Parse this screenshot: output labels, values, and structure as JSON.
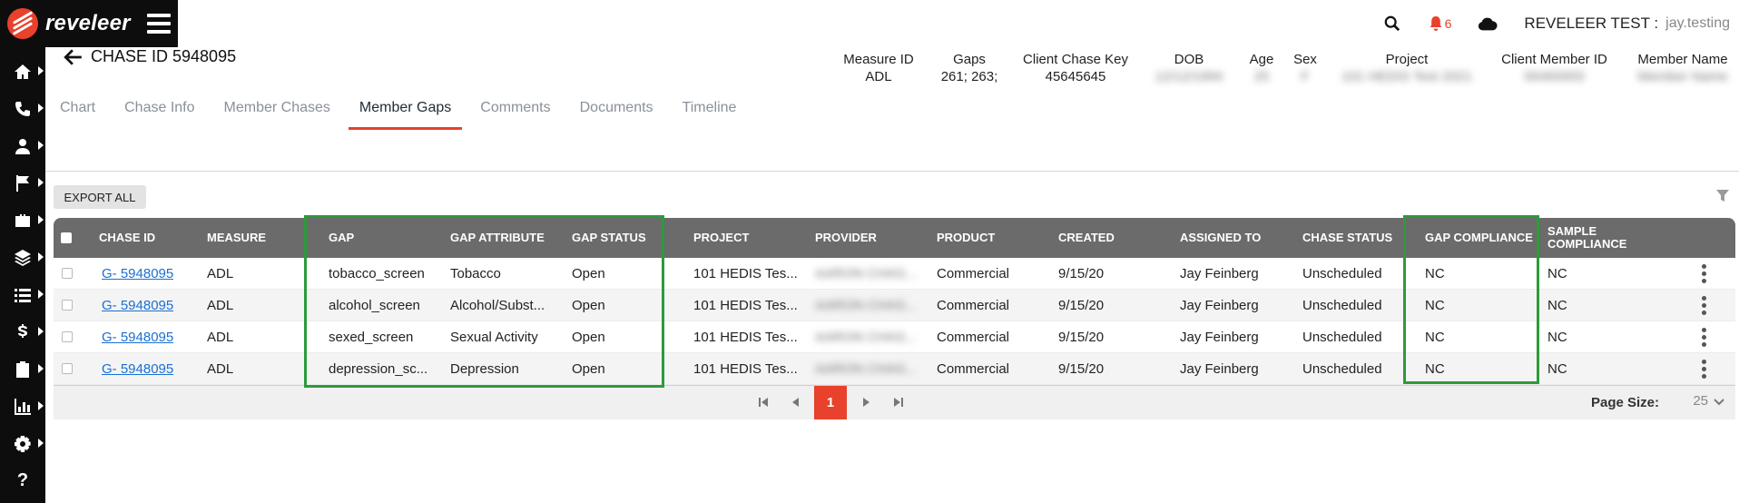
{
  "app": {
    "brand": "reveleer"
  },
  "topbar": {
    "notifications_count": "6",
    "user_label": "REVELEER TEST :",
    "user_name": "jay.testing"
  },
  "header": {
    "title": "CHASE ID 5948095",
    "meta": [
      {
        "label": "Measure ID",
        "value": "ADL",
        "blurred": false
      },
      {
        "label": "Gaps",
        "value": "261; 263;",
        "blurred": false
      },
      {
        "label": "Client Chase Key",
        "value": "45645645",
        "blurred": false
      },
      {
        "label": "DOB",
        "value": "12/12/1994",
        "blurred": true
      },
      {
        "label": "Age",
        "value": "25",
        "blurred": true
      },
      {
        "label": "Sex",
        "value": "F",
        "blurred": true
      },
      {
        "label": "Project",
        "value": "101 HEDIS Test 2021",
        "blurred": true
      },
      {
        "label": "Client Member ID",
        "value": "56465655",
        "blurred": true
      },
      {
        "label": "Member Name",
        "value": "Member Name",
        "blurred": true
      }
    ]
  },
  "tabs": [
    {
      "label": "Chart",
      "active": false
    },
    {
      "label": "Chase Info",
      "active": false
    },
    {
      "label": "Member Chases",
      "active": false
    },
    {
      "label": "Member Gaps",
      "active": true
    },
    {
      "label": "Comments",
      "active": false
    },
    {
      "label": "Documents",
      "active": false
    },
    {
      "label": "Timeline",
      "active": false
    }
  ],
  "toolbar": {
    "export_label": "EXPORT ALL"
  },
  "table": {
    "columns": [
      "CHASE ID",
      "MEASURE",
      "GAP",
      "GAP ATTRIBUTE",
      "GAP STATUS",
      "PROJECT",
      "PROVIDER",
      "PRODUCT",
      "CREATED",
      "ASSIGNED TO",
      "CHASE STATUS",
      "GAP COMPLIANCE",
      "SAMPLE COMPLIANCE"
    ],
    "rows": [
      {
        "chase_id": "G- 5948095",
        "measure": "ADL",
        "gap": "tobacco_screen",
        "gap_attribute": "Tobacco",
        "gap_status": "Open",
        "project": "101 HEDIS Tes...",
        "provider": "AARON CHAS...",
        "product": "Commercial",
        "created": "9/15/20",
        "assigned_to": "Jay Feinberg",
        "chase_status": "Unscheduled",
        "gap_compliance": "NC",
        "sample_compliance": "NC"
      },
      {
        "chase_id": "G- 5948095",
        "measure": "ADL",
        "gap": "alcohol_screen",
        "gap_attribute": "Alcohol/Subst...",
        "gap_status": "Open",
        "project": "101 HEDIS Tes...",
        "provider": "AARON CHAS...",
        "product": "Commercial",
        "created": "9/15/20",
        "assigned_to": "Jay Feinberg",
        "chase_status": "Unscheduled",
        "gap_compliance": "NC",
        "sample_compliance": "NC"
      },
      {
        "chase_id": "G- 5948095",
        "measure": "ADL",
        "gap": "sexed_screen",
        "gap_attribute": "Sexual Activity",
        "gap_status": "Open",
        "project": "101 HEDIS Tes...",
        "provider": "AARON CHAS...",
        "product": "Commercial",
        "created": "9/15/20",
        "assigned_to": "Jay Feinberg",
        "chase_status": "Unscheduled",
        "gap_compliance": "NC",
        "sample_compliance": "NC"
      },
      {
        "chase_id": "G- 5948095",
        "measure": "ADL",
        "gap": "depression_sc...",
        "gap_attribute": "Depression",
        "gap_status": "Open",
        "project": "101 HEDIS Tes...",
        "provider": "AARON CHAS...",
        "product": "Commercial",
        "created": "9/15/20",
        "assigned_to": "Jay Feinberg",
        "chase_status": "Unscheduled",
        "gap_compliance": "NC",
        "sample_compliance": "NC"
      }
    ]
  },
  "pagination": {
    "current_page": "1",
    "page_size_label": "Page Size:",
    "page_size": "25"
  },
  "colors": {
    "accent": "#e8412c",
    "highlight": "#2d9a3a",
    "link": "#1a6fd4",
    "header_bg": "#6b6b6b"
  },
  "icons": [
    "home-icon",
    "phone-icon",
    "user-icon",
    "flag-icon",
    "briefcase-icon",
    "layers-icon",
    "list-icon",
    "dollar-icon",
    "clipboard-icon",
    "chart-icon",
    "gear-icon",
    "help-icon",
    "search-icon",
    "bell-icon",
    "cloud-icon",
    "filter-icon"
  ]
}
